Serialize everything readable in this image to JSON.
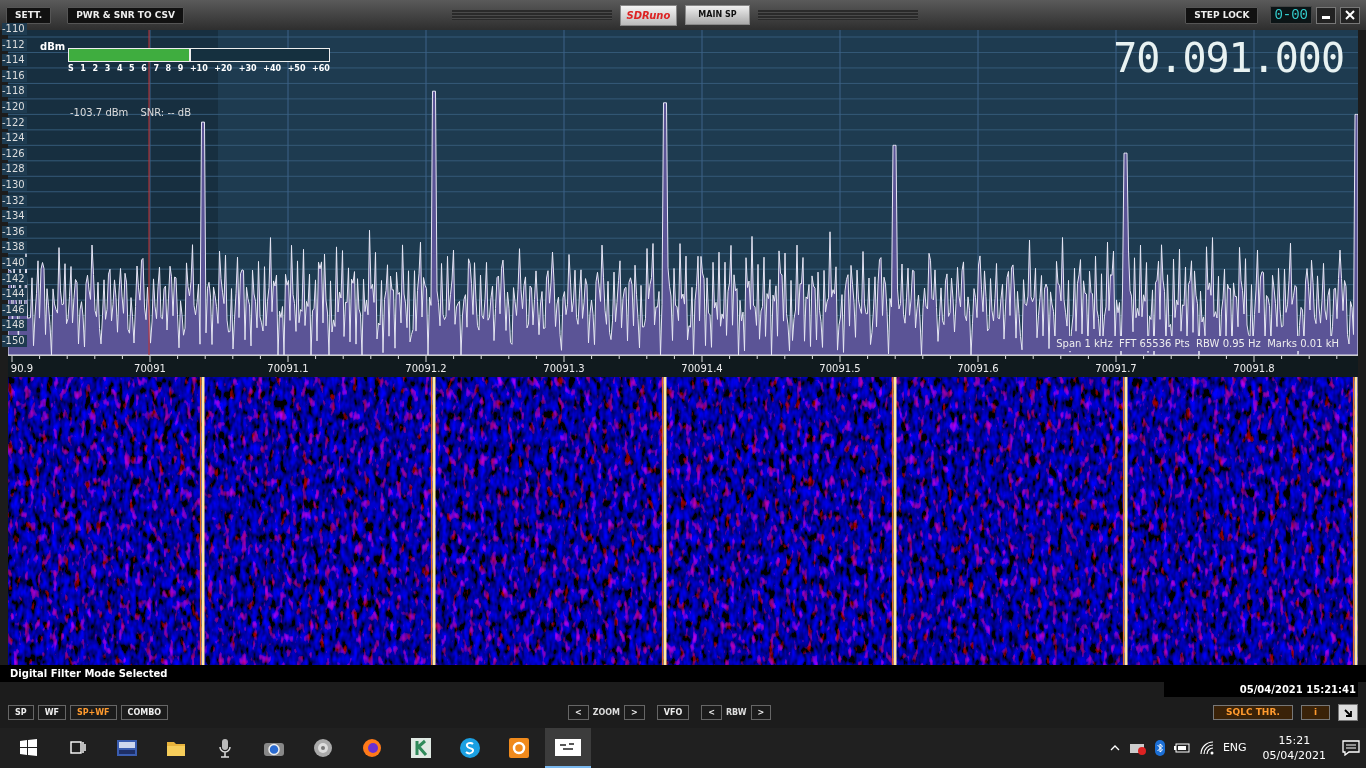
{
  "title_bar": {
    "buttons": [
      "SETT.",
      "PWR & SNR TO CSV"
    ],
    "logo": "SDRuno",
    "panel": "MAIN SP",
    "step_lock": "STEP LOCK",
    "counter": "0-00"
  },
  "spectrum": {
    "unit": "dBm",
    "y_labels": [
      "-110",
      "-112",
      "-114",
      "-116",
      "-118",
      "-120",
      "-122",
      "-124",
      "-126",
      "-128",
      "-130",
      "-132",
      "-134",
      "-136",
      "-138",
      "-140",
      "-142",
      "-144",
      "-146",
      "-148",
      "-150"
    ],
    "s_meter": {
      "scale": [
        "S",
        "1",
        "2",
        "3",
        "4",
        "5",
        "6",
        "7",
        "8",
        "9",
        "+10",
        "+20",
        "+30",
        "+40",
        "+50",
        "+60"
      ],
      "level": 0.47
    },
    "power": "-103.7 dBm",
    "snr": "SNR: -- dB",
    "frequency": "70.091.000",
    "info": "Span 1 kHz  FFT 65536 Pts  RBW 0.95 Hz  Marks 0.01 kH"
  },
  "x_labels": [
    "90.9",
    "70091",
    "70091.1",
    "70091.2",
    "70091.3",
    "70091.4",
    "70091.5",
    "70091.6",
    "70091.7",
    "70091.8"
  ],
  "status": "Digital Filter Mode Selected",
  "timestamp": "05/04/2021 15:21:41",
  "toolbar": {
    "view_buttons": [
      {
        "label": "SP",
        "selected": false
      },
      {
        "label": "WF",
        "selected": false
      },
      {
        "label": "SP+WF",
        "selected": true
      },
      {
        "label": "COMBO",
        "selected": false
      }
    ],
    "zoom": {
      "prev": "<",
      "label": "ZOOM",
      "next": ">"
    },
    "vfo": "VFO",
    "rbw": {
      "prev": "<",
      "label": "RBW",
      "next": ">"
    },
    "sqlc": "SQLC THR.",
    "info": "i"
  },
  "taskbar": {
    "apps": [
      {
        "kind": "start",
        "active": false
      },
      {
        "kind": "taskview",
        "active": false
      },
      {
        "kind": "radio",
        "active": false
      },
      {
        "kind": "folder",
        "active": false
      },
      {
        "kind": "microphone",
        "active": false
      },
      {
        "kind": "camera",
        "active": false
      },
      {
        "kind": "speaker",
        "active": false
      },
      {
        "kind": "browser",
        "active": false
      },
      {
        "kind": "kapp",
        "active": false
      },
      {
        "kind": "chat",
        "active": false
      },
      {
        "kind": "gapp",
        "active": false
      },
      {
        "kind": "window",
        "active": true
      }
    ],
    "language": "ENG",
    "time": "15:21",
    "date": "05/04/2021"
  }
}
